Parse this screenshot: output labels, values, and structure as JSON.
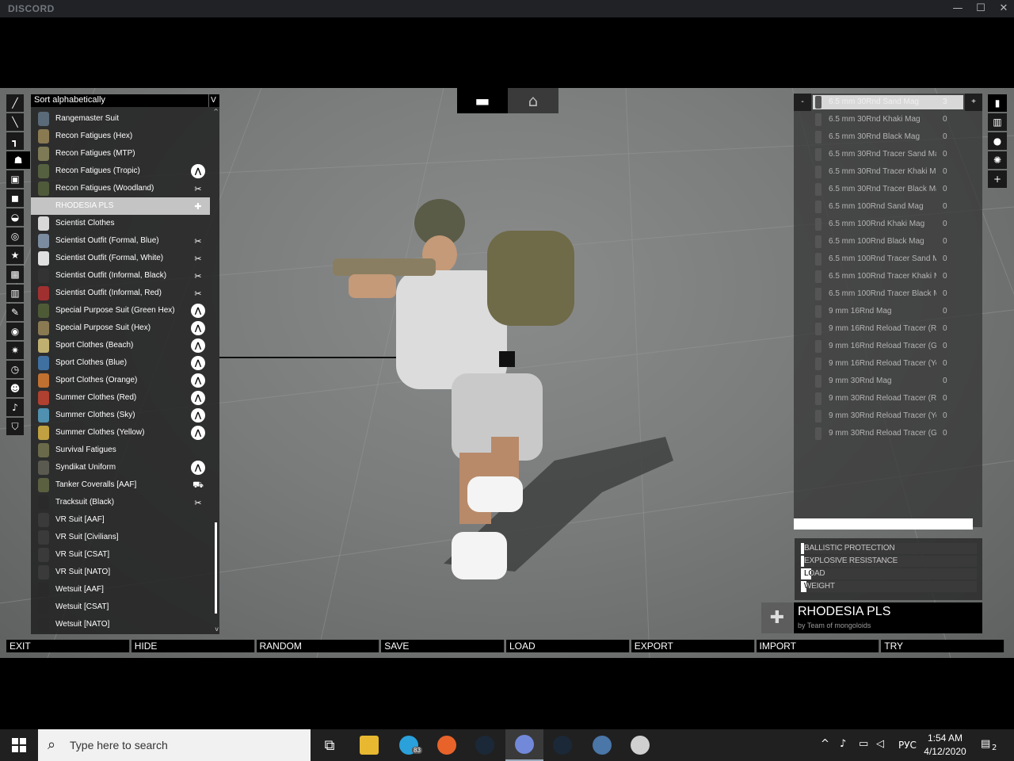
{
  "titlebar": {
    "app_name": "DISCORD",
    "minimize": "—",
    "maximize": "☐",
    "close": "✕"
  },
  "top_tabs": [
    {
      "name": "weapons",
      "icon": "pistol-icon",
      "glyph": "▬"
    },
    {
      "name": "storage",
      "icon": "garage-icon",
      "glyph": "⌂"
    }
  ],
  "left_categories": [
    {
      "icon": "knife-icon",
      "glyph": "╱"
    },
    {
      "icon": "launcher-icon",
      "glyph": "╲"
    },
    {
      "icon": "handgun-icon",
      "glyph": "┓"
    },
    {
      "icon": "uniform-icon",
      "glyph": "☗",
      "active": true
    },
    {
      "icon": "vest-icon",
      "glyph": "▣"
    },
    {
      "icon": "backpack-icon",
      "glyph": "◼"
    },
    {
      "icon": "helmet-icon",
      "glyph": "◒"
    },
    {
      "icon": "goggles-icon",
      "glyph": "◎"
    },
    {
      "icon": "insignia-icon",
      "glyph": "★"
    },
    {
      "icon": "binoculars-icon",
      "glyph": "▩"
    },
    {
      "icon": "map-icon",
      "glyph": "▥"
    },
    {
      "icon": "gps-icon",
      "glyph": "✎"
    },
    {
      "icon": "radio-icon",
      "glyph": "◉"
    },
    {
      "icon": "compass-icon",
      "glyph": "✷"
    },
    {
      "icon": "watch-icon",
      "glyph": "◷"
    },
    {
      "icon": "face-icon",
      "glyph": "☻"
    },
    {
      "icon": "voice-icon",
      "glyph": "♪"
    },
    {
      "icon": "insignia-shield-icon",
      "glyph": "⛉"
    }
  ],
  "sort": {
    "label": "Sort alphabetically",
    "arrow": "V"
  },
  "items": [
    {
      "name": "Rangemaster Suit",
      "color": "#5a6a78",
      "badge": ""
    },
    {
      "name": "Recon Fatigues (Hex)",
      "color": "#8a7a52",
      "badge": ""
    },
    {
      "name": "Recon Fatigues (MTP)",
      "color": "#7d7a55",
      "badge": ""
    },
    {
      "name": "Recon Fatigues (Tropic)",
      "color": "#556040",
      "badge": "arma"
    },
    {
      "name": "Recon Fatigues (Woodland)",
      "color": "#4f5a3a",
      "badge": "dlc"
    },
    {
      "name": "RHODESIA PLS",
      "color": "#c4c4c4",
      "badge": "mod",
      "selected": true
    },
    {
      "name": "Scientist Clothes",
      "color": "#d8d8d8",
      "badge": ""
    },
    {
      "name": "Scientist Outfit (Formal, Blue)",
      "color": "#7c8ca0",
      "badge": "dlc"
    },
    {
      "name": "Scientist Outfit (Formal, White)",
      "color": "#e0e0e0",
      "badge": "dlc"
    },
    {
      "name": "Scientist Outfit (Informal, Black)",
      "color": "#333333",
      "badge": "dlc"
    },
    {
      "name": "Scientist Outfit (Informal, Red)",
      "color": "#a03030",
      "badge": "dlc"
    },
    {
      "name": "Special Purpose Suit (Green Hex)",
      "color": "#4e5a36",
      "badge": "arma"
    },
    {
      "name": "Special Purpose Suit (Hex)",
      "color": "#8a7a52",
      "badge": "arma"
    },
    {
      "name": "Sport Clothes (Beach)",
      "color": "#c0b070",
      "badge": "arma"
    },
    {
      "name": "Sport Clothes (Blue)",
      "color": "#4070a0",
      "badge": "arma"
    },
    {
      "name": "Sport Clothes (Orange)",
      "color": "#c07030",
      "badge": "arma"
    },
    {
      "name": "Summer Clothes (Red)",
      "color": "#b04030",
      "badge": "arma"
    },
    {
      "name": "Summer Clothes (Sky)",
      "color": "#5090b0",
      "badge": "arma"
    },
    {
      "name": "Summer Clothes (Yellow)",
      "color": "#c0a040",
      "badge": "arma"
    },
    {
      "name": "Survival Fatigues",
      "color": "#6a6a4a",
      "badge": ""
    },
    {
      "name": "Syndikat Uniform",
      "color": "#5a5a50",
      "badge": "arma"
    },
    {
      "name": "Tanker Coveralls [AAF]",
      "color": "#5a6040",
      "badge": "tank"
    },
    {
      "name": "Tracksuit (Black)",
      "color": "#2a2a2a",
      "badge": "dlc"
    },
    {
      "name": "VR Suit [AAF]",
      "color": "#3a3a3a",
      "badge": ""
    },
    {
      "name": "VR Suit [Civilians]",
      "color": "#3a3a3a",
      "badge": ""
    },
    {
      "name": "VR Suit [CSAT]",
      "color": "#3a3a3a",
      "badge": ""
    },
    {
      "name": "VR Suit [NATO]",
      "color": "#3a3a3a",
      "badge": ""
    },
    {
      "name": "Wetsuit [AAF]",
      "color": "#2a2a2a",
      "badge": ""
    },
    {
      "name": "Wetsuit [CSAT]",
      "color": "#2a2a2a",
      "badge": ""
    },
    {
      "name": "Wetsuit [NATO]",
      "color": "#2a2a2a",
      "badge": ""
    }
  ],
  "badges": {
    "arma": "⋀",
    "dlc": "✂",
    "mod": "✚",
    "tank": "⛟"
  },
  "magazines": [
    {
      "name": "6.5 mm 30Rnd Sand Mag",
      "count": "3"
    },
    {
      "name": "6.5 mm 30Rnd Khaki Mag",
      "count": "0"
    },
    {
      "name": "6.5 mm 30Rnd Black Mag",
      "count": "0"
    },
    {
      "name": "6.5 mm 30Rnd Tracer Sand Mag",
      "count": "0"
    },
    {
      "name": "6.5 mm 30Rnd Tracer Khaki Mag",
      "count": "0"
    },
    {
      "name": "6.5 mm 30Rnd Tracer Black Mag",
      "count": "0"
    },
    {
      "name": "6.5 mm 100Rnd Sand Mag",
      "count": "0"
    },
    {
      "name": "6.5 mm 100Rnd Khaki Mag",
      "count": "0"
    },
    {
      "name": "6.5 mm 100Rnd Black Mag",
      "count": "0"
    },
    {
      "name": "6.5 mm 100Rnd Tracer Sand Mag",
      "count": "0"
    },
    {
      "name": "6.5 mm 100Rnd Tracer Khaki Mag",
      "count": "0"
    },
    {
      "name": "6.5 mm 100Rnd Tracer Black Mag",
      "count": "0"
    },
    {
      "name": "9 mm 16Rnd Mag",
      "count": "0"
    },
    {
      "name": "9 mm 16Rnd Reload Tracer (Red...",
      "count": "0"
    },
    {
      "name": "9 mm 16Rnd Reload Tracer (Gre...",
      "count": "0"
    },
    {
      "name": "9 mm 16Rnd Reload Tracer (Yell...",
      "count": "0"
    },
    {
      "name": "9 mm 30Rnd Mag",
      "count": "0"
    },
    {
      "name": "9 mm 30Rnd Reload Tracer (Red...",
      "count": "0"
    },
    {
      "name": "9 mm 30Rnd Reload Tracer (Yell...",
      "count": "0"
    },
    {
      "name": "9 mm 30Rnd Reload Tracer (Gre...",
      "count": "0"
    }
  ],
  "mag_controls": {
    "minus": "-",
    "plus": "+"
  },
  "load_fill": 0.99,
  "right_icons": [
    {
      "icon": "magazine-icon",
      "glyph": "▮",
      "active": true
    },
    {
      "icon": "magazines-icon",
      "glyph": "▥"
    },
    {
      "icon": "grenade-icon",
      "glyph": "●"
    },
    {
      "icon": "explosive-icon",
      "glyph": "✺"
    },
    {
      "icon": "misc-plus-icon",
      "glyph": "+"
    }
  ],
  "stats": [
    {
      "label": "BALLISTIC PROTECTION",
      "value": 0.01
    },
    {
      "label": "EXPLOSIVE RESISTANCE",
      "value": 0.01
    },
    {
      "label": "LOAD",
      "value": 0.06
    },
    {
      "label": "WEIGHT",
      "value": 0.03
    }
  ],
  "info": {
    "icon_glyph": "✚",
    "name": "RHODESIA PLS",
    "author": "by Team of mongoloids"
  },
  "bottom_buttons": [
    "EXIT",
    "HIDE",
    "RANDOM",
    "SAVE",
    "LOAD",
    "EXPORT",
    "IMPORT",
    "TRY"
  ],
  "taskbar": {
    "search_placeholder": "Type here to search",
    "apps": [
      {
        "name": "task-view",
        "color": "#202020",
        "glyph": "⧉"
      },
      {
        "name": "file-explorer",
        "color": "#e8b830",
        "glyph": ""
      },
      {
        "name": "telegram",
        "color": "#2aa1da",
        "glyph": ""
      },
      {
        "name": "firefox",
        "color": "#e8632a",
        "glyph": ""
      },
      {
        "name": "steam",
        "color": "#1b2838",
        "glyph": ""
      },
      {
        "name": "discord",
        "color": "#7289da",
        "glyph": "",
        "active": true
      },
      {
        "name": "steam-2",
        "color": "#1b2838",
        "glyph": ""
      },
      {
        "name": "vk",
        "color": "#4a76a8",
        "glyph": ""
      },
      {
        "name": "fox-app",
        "color": "#d0d0d0",
        "glyph": ""
      }
    ],
    "telegram_badge": "83",
    "language": "РУС",
    "time": "1:54 AM",
    "date": "4/12/2020",
    "notifications": "2"
  }
}
